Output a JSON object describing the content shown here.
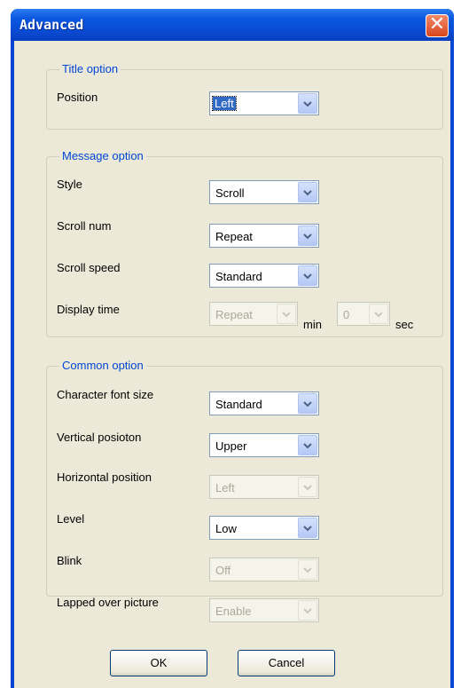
{
  "window": {
    "title": "Advanced"
  },
  "title_option": {
    "legend": "Title option",
    "position_label": "Position",
    "position_value": "Left"
  },
  "message_option": {
    "legend": "Message option",
    "style_label": "Style",
    "style_value": "Scroll",
    "scroll_num_label": "Scroll num",
    "scroll_num_value": "Repeat",
    "scroll_speed_label": "Scroll speed",
    "scroll_speed_value": "Standard",
    "display_time_label": "Display time",
    "display_time_value": "Repeat",
    "min_unit": "min",
    "seconds_value": "0",
    "sec_unit": "sec"
  },
  "common_option": {
    "legend": "Common option",
    "font_size_label": "Character font size",
    "font_size_value": "Standard",
    "vertical_label": "Vertical posioton",
    "vertical_value": "Upper",
    "horizontal_label": "Horizontal position",
    "horizontal_value": "Left",
    "level_label": "Level",
    "level_value": "Low",
    "blink_label": "Blink",
    "blink_value": "Off",
    "lapped_label": "Lapped over picture",
    "lapped_value": "Enable"
  },
  "buttons": {
    "ok": "OK",
    "cancel": "Cancel"
  },
  "icons": {
    "close": "close-icon",
    "dropdown": "chevron-down-icon"
  },
  "colors": {
    "titlebar": "#0a4ad2",
    "dialog_bg": "#ece9d8",
    "legend": "#0046d5",
    "close": "#d9461d"
  }
}
